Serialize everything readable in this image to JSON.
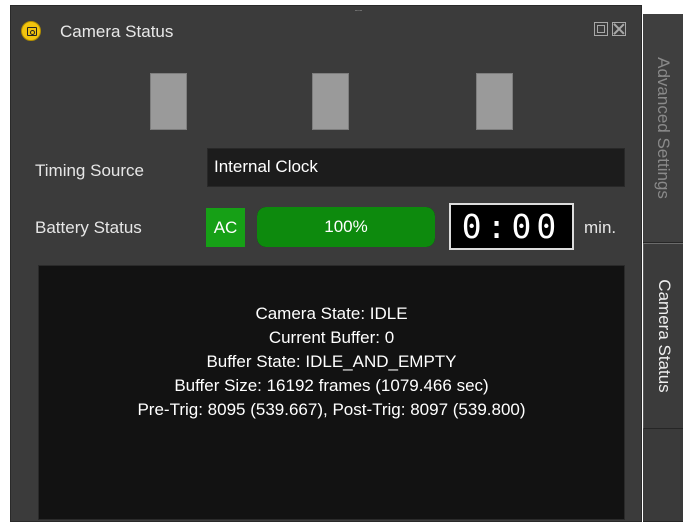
{
  "window": {
    "title": "Camera Status",
    "grip": "......"
  },
  "side_tabs": [
    {
      "label": "Advanced Settings",
      "active": false
    },
    {
      "label": "Camera Status",
      "active": true
    }
  ],
  "timing": {
    "label": "Timing Source",
    "value": "Internal Clock"
  },
  "battery": {
    "label": "Battery Status",
    "power_source": "AC",
    "percent_text": "100%",
    "level_percent": 100,
    "timer": "0:00",
    "timer_unit": "min."
  },
  "status": {
    "lines": [
      "Camera State: IDLE",
      "Current Buffer: 0",
      "Buffer State: IDLE_AND_EMPTY",
      "Buffer Size: 16192 frames (1079.466 sec)",
      "Pre-Trig: 8095 (539.667), Post-Trig: 8097 (539.800)"
    ]
  },
  "colors": {
    "panel_bg": "#3b3b3b",
    "accent_green": "#16a016",
    "battery_fill": "#0d8a0d",
    "indicator_gray": "#9a9a9a",
    "title_icon": "#f2c40e"
  },
  "icons": {
    "title": "camera-icon",
    "float": "float-window-icon",
    "close": "close-icon"
  }
}
